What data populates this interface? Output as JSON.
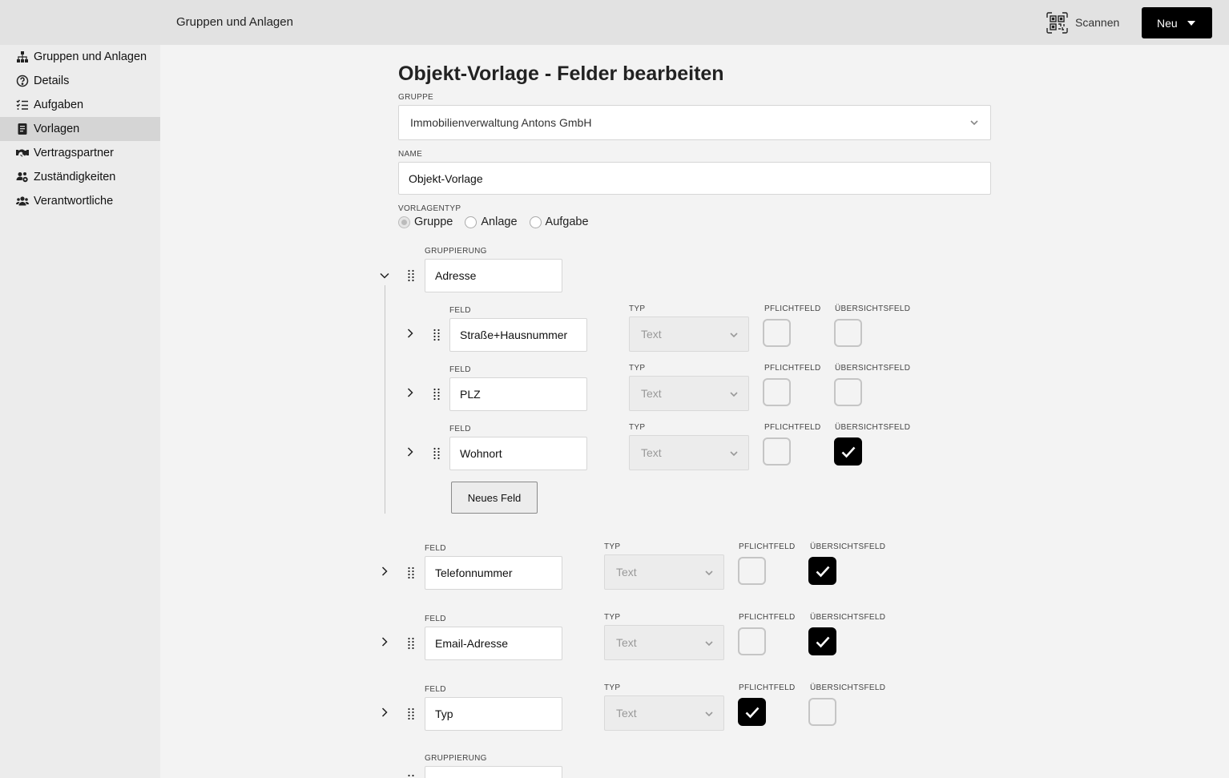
{
  "header": {
    "title": "Gruppen und Anlagen",
    "scan_label": "Scannen",
    "new_label": "Neu"
  },
  "sidebar": {
    "items": [
      {
        "label": "Gruppen und Anlagen",
        "icon": "sitemap-icon",
        "active": false
      },
      {
        "label": "Details",
        "icon": "question-circle-icon",
        "active": false
      },
      {
        "label": "Aufgaben",
        "icon": "list-check-icon",
        "active": false
      },
      {
        "label": "Vorlagen",
        "icon": "document-icon",
        "active": true
      },
      {
        "label": "Vertragspartner",
        "icon": "handshake-icon",
        "active": false
      },
      {
        "label": "Zuständigkeiten",
        "icon": "users-gear-icon",
        "active": false
      },
      {
        "label": "Verantwortliche",
        "icon": "users-icon",
        "active": false
      }
    ]
  },
  "form": {
    "heading": "Objekt-Vorlage - Felder bearbeiten",
    "gruppe_label": "GRUPPE",
    "gruppe_value": "Immobilienverwaltung Antons GmbH",
    "name_label": "NAME",
    "name_value": "Objekt-Vorlage",
    "vorlagentyp_label": "VORLAGENTYP",
    "vorlagentyp_options": [
      "Gruppe",
      "Anlage",
      "Aufgabe"
    ],
    "vorlagentyp_selected": "Gruppe"
  },
  "labels": {
    "gruppierung": "GRUPPIERUNG",
    "feld": "FELD",
    "typ": "TYP",
    "pflichtfeld": "PFLICHTFELD",
    "uebersichtsfeld": "ÜBERSICHTSFELD"
  },
  "group1": {
    "name": "Adresse",
    "fields": [
      {
        "name": "Straße+Hausnummer",
        "typ": "Text",
        "pflicht": false,
        "uebersicht": false
      },
      {
        "name": "PLZ",
        "typ": "Text",
        "pflicht": false,
        "uebersicht": false
      },
      {
        "name": "Wohnort",
        "typ": "Text",
        "pflicht": false,
        "uebersicht": true
      }
    ],
    "new_field_label": "Neues Feld"
  },
  "fields": [
    {
      "name": "Telefonnummer",
      "typ": "Text",
      "pflicht": false,
      "uebersicht": true
    },
    {
      "name": "Email-Adresse",
      "typ": "Text",
      "pflicht": false,
      "uebersicht": true
    },
    {
      "name": "Typ",
      "typ": "Text",
      "pflicht": true,
      "uebersicht": false
    }
  ],
  "group2": {
    "name": ""
  }
}
